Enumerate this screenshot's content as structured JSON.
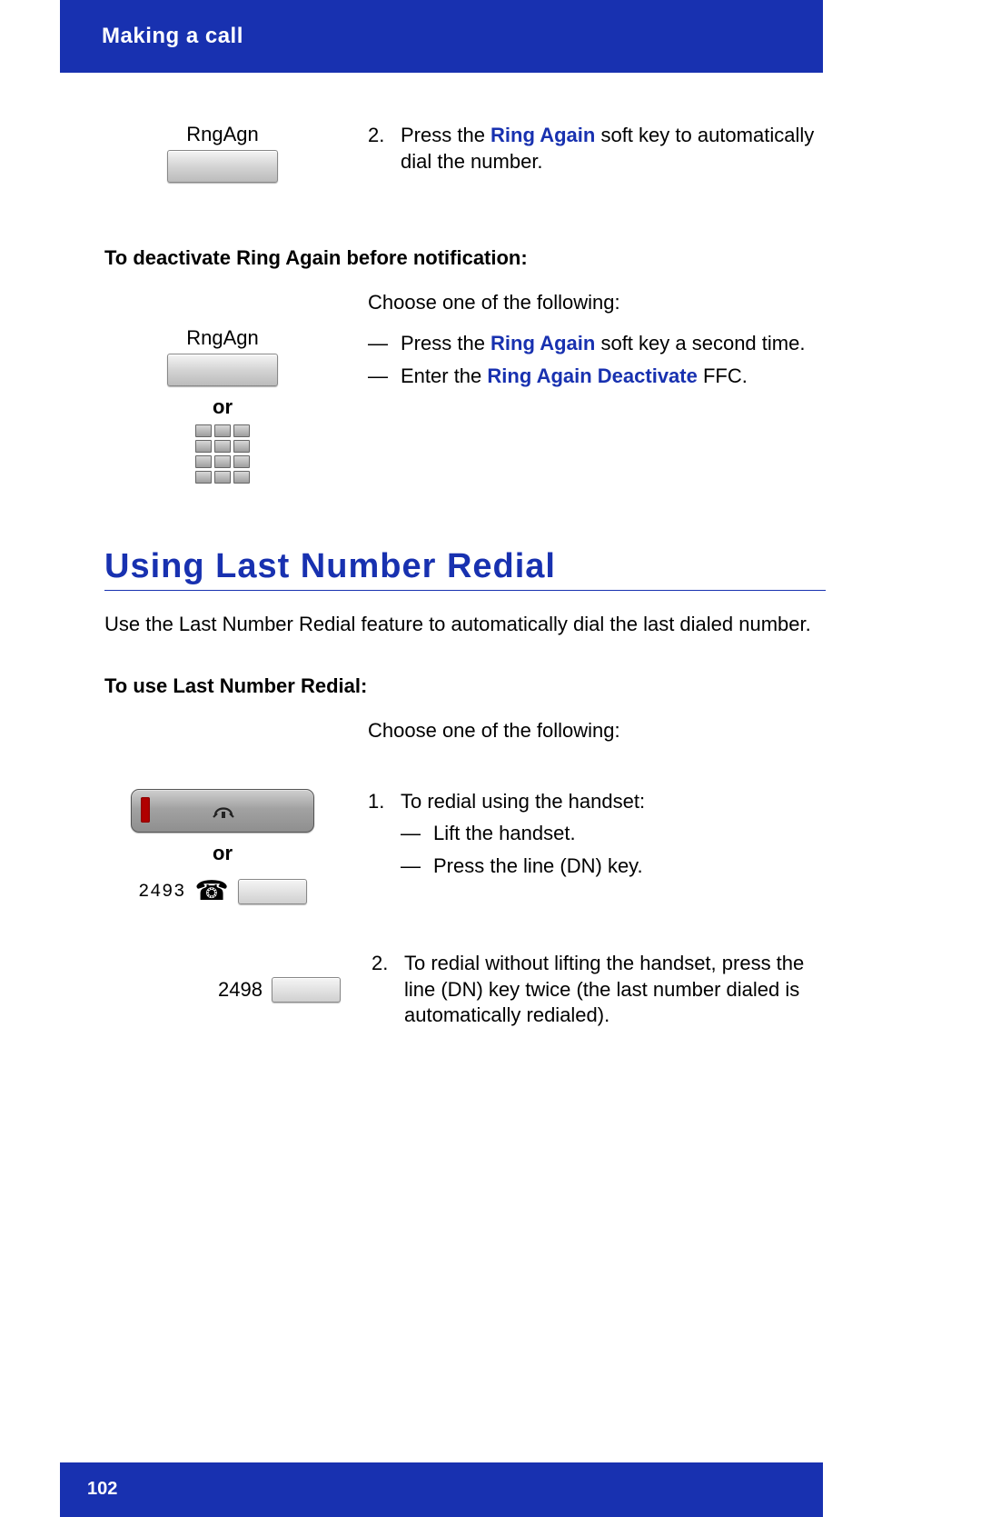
{
  "header": {
    "title": "Making a call"
  },
  "step2": {
    "softkey_label": "RngAgn",
    "num": "2.",
    "before": "Press the ",
    "link": "Ring Again",
    "after": " soft key to automatically dial the number."
  },
  "deactivate": {
    "heading": "To deactivate Ring Again before notification:",
    "softkey_label": "RngAgn",
    "or": "or",
    "intro": "Choose one of the following:",
    "item1_before": "Press the ",
    "item1_link": "Ring Again",
    "item1_after": " soft key a second time.",
    "item2_before": "Enter the ",
    "item2_link": "Ring Again Deactivate",
    "item2_after": " FFC."
  },
  "section": {
    "title": "Using Last Number Redial",
    "intro": "Use the Last Number Redial feature to automatically dial the last dialed number.",
    "heading": "To use Last Number Redial:",
    "choose": "Choose one of the following:",
    "step1": {
      "num": "1.",
      "text": "To redial using the handset:",
      "sub1": "Lift the handset.",
      "sub2": "Press the line (DN) key.",
      "line_num": "2493",
      "or": "or"
    },
    "step2": {
      "num": "2.",
      "line_num": "2498",
      "text": "To redial without lifting the handset, press the line (DN) key twice (the last number dialed is automatically redialed)."
    }
  },
  "footer": {
    "page": "102"
  }
}
